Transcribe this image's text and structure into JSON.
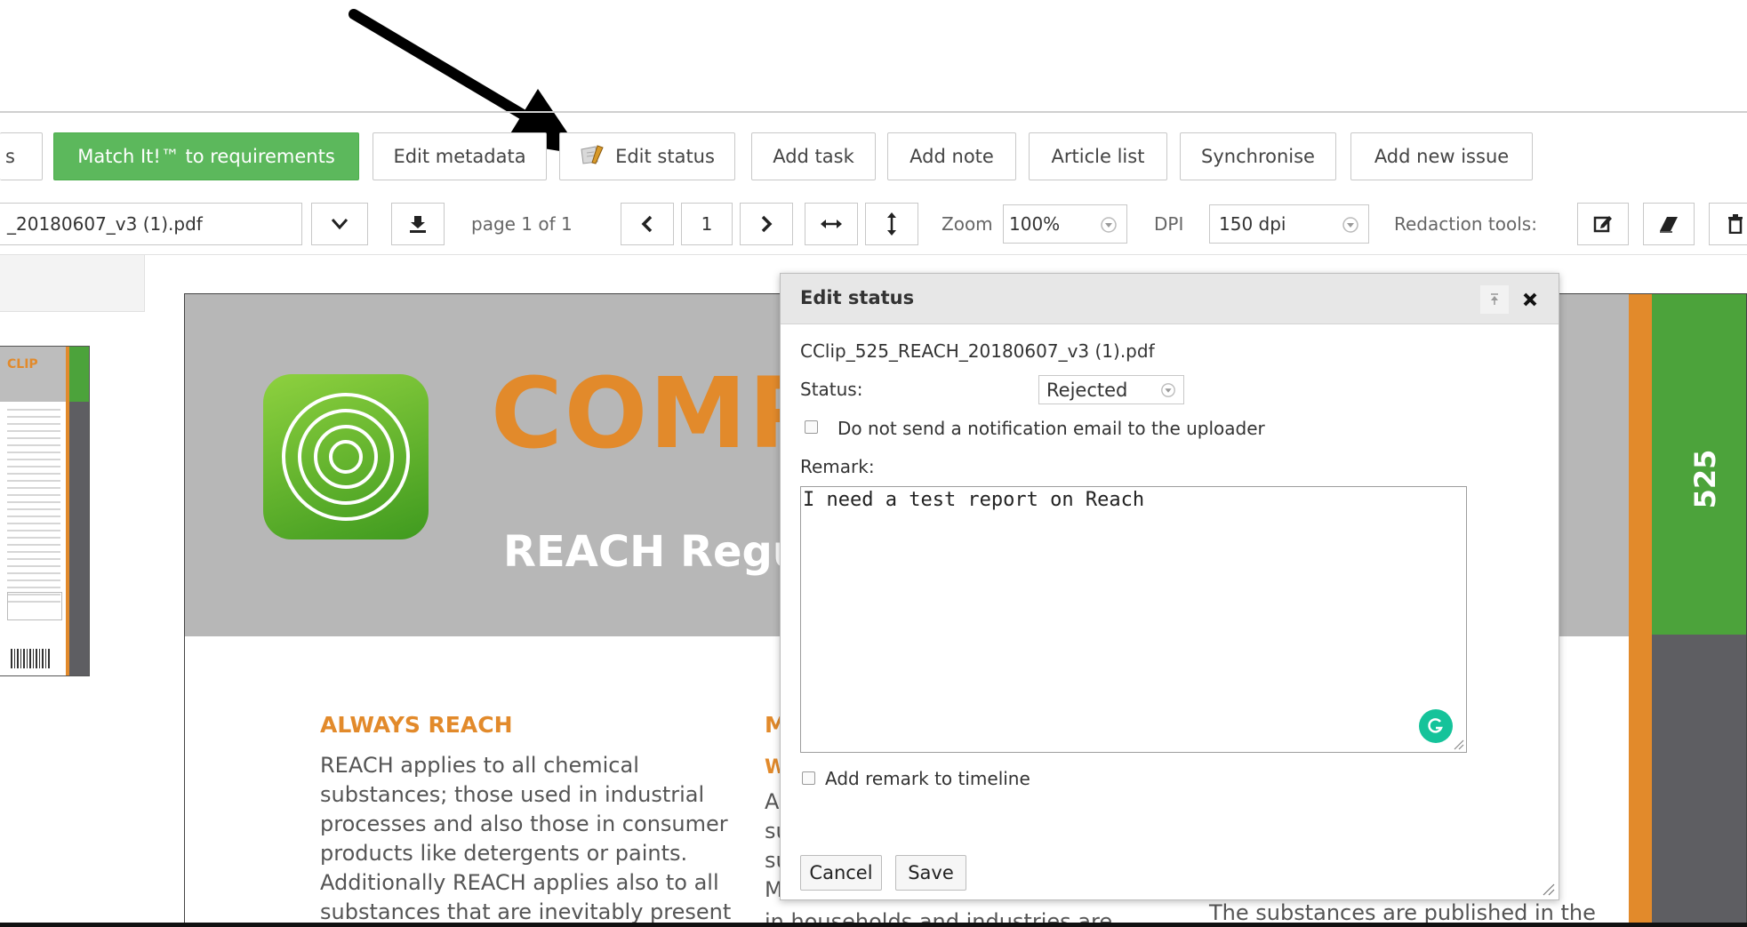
{
  "toolbar": {
    "left_cut_label": "s",
    "match_label": "Match It!™ to requirements",
    "edit_metadata_label": "Edit metadata",
    "edit_status_label": "Edit status",
    "add_task_label": "Add task",
    "add_note_label": "Add note",
    "article_list_label": "Article list",
    "synchronise_label": "Synchronise",
    "add_new_issue_label": "Add new issue"
  },
  "viewer": {
    "file_name": "_20180607_v3 (1).pdf",
    "page_label": "page 1 of 1",
    "page_number": "1",
    "zoom_label": "Zoom",
    "zoom_value": "100%",
    "dpi_label": "DPI",
    "dpi_value": "150 dpi",
    "redaction_label": "Redaction tools:"
  },
  "document": {
    "thumb_title": "CLIP",
    "heading": "COMP",
    "subheading": "REACH Regula",
    "side_number": "525",
    "col1_title": "ALWAYS REACH",
    "col1_lines": [
      "REACH applies to all chemical",
      "substances; those used in industrial",
      "processes and also those in consumer",
      "products like detergents or paints.",
      "Additionally REACH applies also to all",
      "substances that are inevitably present"
    ],
    "col2_title_cut": "M",
    "col2_sub_cut": "W",
    "col2_cut_lines": [
      "A",
      "su",
      "su",
      "M"
    ],
    "col2_bottom": "in households and industries are",
    "col3_bottom": "The substances are published in the"
  },
  "dialog": {
    "title": "Edit status",
    "file_name": "CClip_525_REACH_20180607_v3 (1).pdf",
    "status_label": "Status:",
    "status_value": "Rejected",
    "notify_label": "Do not send a notification email to the uploader",
    "remark_label": "Remark:",
    "remark_value": "I need a test report on Reach",
    "timeline_label": "Add remark to timeline",
    "cancel_label": "Cancel",
    "save_label": "Save"
  },
  "colors": {
    "green_button": "#5cb85c",
    "brand_orange": "#e28a2b",
    "brand_green": "#4ca33b",
    "dialog_header": "#e7e7e7"
  }
}
